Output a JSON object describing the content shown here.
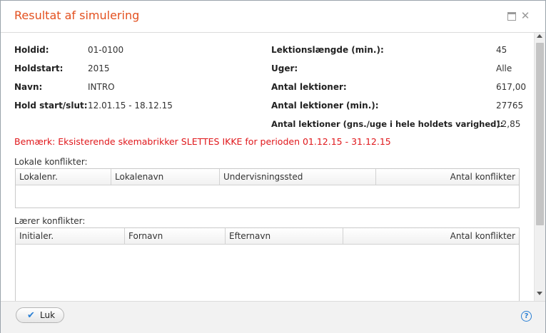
{
  "dialog": {
    "title": "Resultat af simulering",
    "accent_color": "#e3501f"
  },
  "info_left": [
    {
      "label": "Holdid:",
      "value": "01-0100"
    },
    {
      "label": "Holdstart:",
      "value": "2015"
    },
    {
      "label": "Navn:",
      "value": "INTRO"
    },
    {
      "label": "Hold start/slut:",
      "value": "12.01.15 - 18.12.15"
    }
  ],
  "info_right": [
    {
      "label": "Lektionslængde (min.):",
      "value": "45"
    },
    {
      "label": "Uger:",
      "value": "Alle"
    },
    {
      "label": "Antal lektioner:",
      "value": "617,00"
    },
    {
      "label": "Antal lektioner (min.):",
      "value": "27765"
    },
    {
      "label": "Antal lektioner (gns./uge i hele holdets varighed):",
      "value": "12,85"
    }
  ],
  "warning": {
    "text": "Bemærk: Eksisterende skemabrikker SLETTES IKKE for perioden 01.12.15 - 31.12.15",
    "color": "#e0171b"
  },
  "room_conflicts": {
    "label": "Lokale konflikter:",
    "columns": [
      "Lokalenr.",
      "Lokalenavn",
      "Undervisningssted",
      "Antal konflikter"
    ],
    "rows": []
  },
  "teacher_conflicts": {
    "label": "Lærer konflikter:",
    "columns": [
      "Initialer.",
      "Fornavn",
      "Efternavn",
      "Antal konflikter"
    ],
    "rows": []
  },
  "footer": {
    "close_label": "Luk",
    "help_icon": "question-circle-icon"
  }
}
